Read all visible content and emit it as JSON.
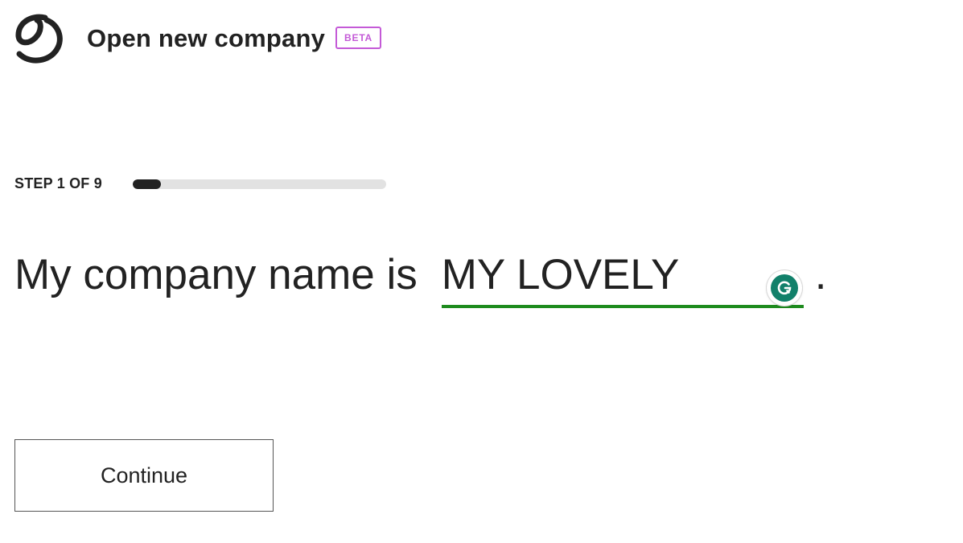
{
  "header": {
    "title": "Open new company",
    "badge": "BETA",
    "logo_icon": "brand-logo-icon"
  },
  "step": {
    "label": "STEP 1 OF 9",
    "current": 1,
    "total": 9,
    "progress_fraction": 0.111
  },
  "form": {
    "prompt": "My company name is",
    "company_name_value": "MY LOVELY",
    "period": ".",
    "grammarly_icon": "grammarly-icon"
  },
  "actions": {
    "continue_label": "Continue"
  },
  "colors": {
    "text": "#222222",
    "badge": "#c45ad7",
    "progress_track": "#e2e2e2",
    "progress_fill": "#222222",
    "input_underline": "#1e8b1e",
    "grammarly": "#11806a"
  }
}
